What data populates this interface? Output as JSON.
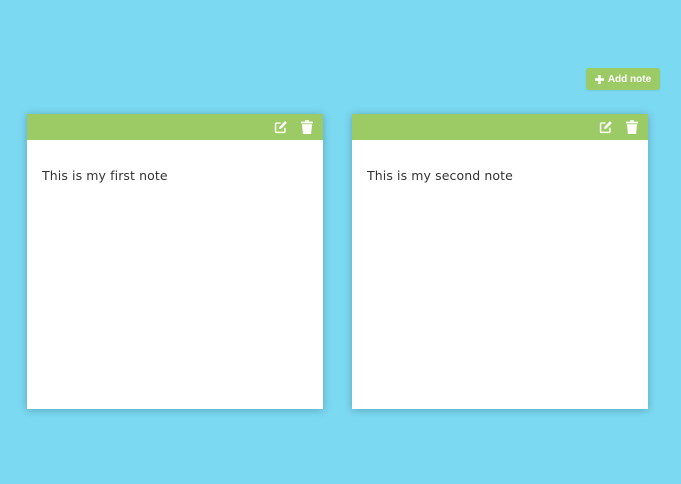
{
  "toolbar": {
    "add_note_label": "Add note",
    "add_note_icon": "plus-icon"
  },
  "notes": [
    {
      "text": "This is my first note",
      "edit_icon": "edit-icon",
      "delete_icon": "trash-icon"
    },
    {
      "text": "This is my second note",
      "edit_icon": "edit-icon",
      "delete_icon": "trash-icon"
    }
  ],
  "colors": {
    "background": "#7BD9F2",
    "accent": "#9CCB65",
    "note_background": "#FFFFFF",
    "text": "#333333"
  }
}
